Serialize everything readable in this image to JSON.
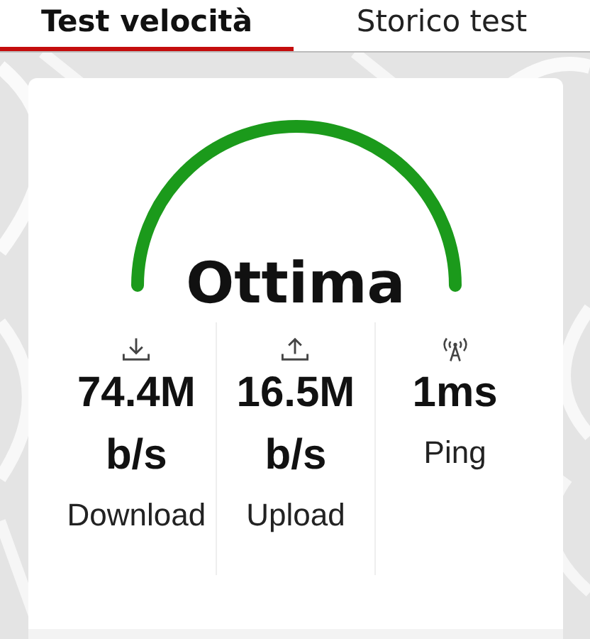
{
  "tabs": [
    {
      "label": "Test velocità",
      "selected": true
    },
    {
      "label": "Storico test",
      "selected": false
    }
  ],
  "result": {
    "rating": "Ottima",
    "stats": [
      {
        "kind": "download",
        "value": "74.4Mb/s",
        "label": "Download"
      },
      {
        "kind": "upload",
        "value": "16.5Mb/s",
        "label": "Upload"
      },
      {
        "kind": "ping",
        "value": "1ms",
        "label": "Ping"
      }
    ]
  }
}
